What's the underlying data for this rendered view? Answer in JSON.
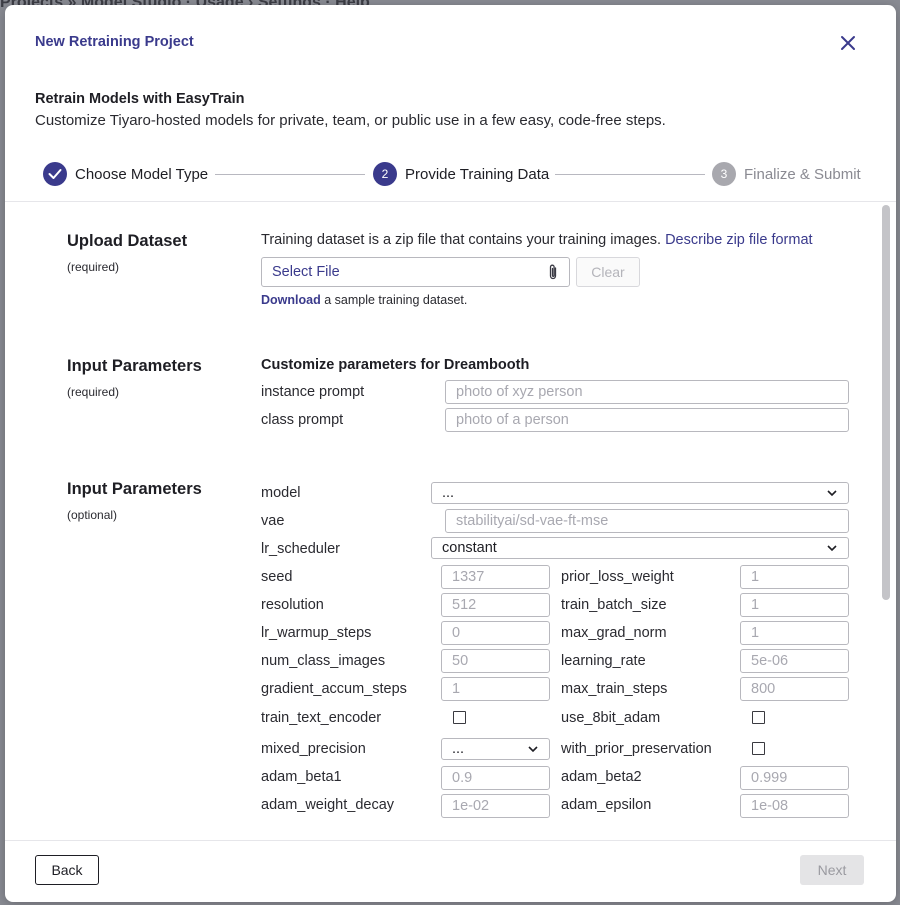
{
  "backdrop": {
    "text": "Projects  »  Model Studio  ·  Usage  ›  Settings  ·  Help"
  },
  "modal": {
    "title": "New Retraining Project",
    "intro_title": "Retrain Models with EasyTrain",
    "intro_subtitle": "Customize Tiyaro-hosted models for private, team, or public use in a few easy, code-free steps."
  },
  "stepper": {
    "steps": [
      {
        "number": "✓",
        "label": "Choose Model Type",
        "state": "completed"
      },
      {
        "number": "2",
        "label": "Provide Training Data",
        "state": "active"
      },
      {
        "number": "3",
        "label": "Finalize & Submit",
        "state": "pending"
      }
    ],
    "colors": {
      "completed": "#3a3a8c",
      "active": "#3a3a8c",
      "pending": "#a8a8ae"
    }
  },
  "upload": {
    "title": "Upload Dataset",
    "subtitle": "(required)",
    "description": "Training dataset is a zip file that contains your training images.",
    "describe_link": "Describe zip file format",
    "select_file": "Select File",
    "clear": "Clear",
    "download_link": "Download",
    "download_text": "a sample training dataset.",
    "icons": {
      "file": "paperclip-icon"
    }
  },
  "required_params": {
    "title": "Input Parameters",
    "subtitle": "(required)",
    "heading": "Customize parameters for Dreambooth",
    "instance_prompt": {
      "label": "instance prompt",
      "placeholder": "photo of xyz person",
      "value": ""
    },
    "class_prompt": {
      "label": "class prompt",
      "placeholder": "photo of a person",
      "value": ""
    }
  },
  "optional_params": {
    "title": "Input Parameters",
    "subtitle": "(optional)",
    "model": {
      "label": "model",
      "value": "..."
    },
    "vae": {
      "label": "vae",
      "placeholder": "stabilityai/sd-vae-ft-mse"
    },
    "lr_scheduler": {
      "label": "lr_scheduler",
      "value": "constant"
    },
    "seed": {
      "label": "seed",
      "placeholder": "1337"
    },
    "prior_loss_weight": {
      "label": "prior_loss_weight",
      "placeholder": "1"
    },
    "resolution": {
      "label": "resolution",
      "placeholder": "512"
    },
    "train_batch_size": {
      "label": "train_batch_size",
      "placeholder": "1"
    },
    "lr_warmup_steps": {
      "label": "lr_warmup_steps",
      "placeholder": "0"
    },
    "max_grad_norm": {
      "label": "max_grad_norm",
      "placeholder": "1"
    },
    "num_class_images": {
      "label": "num_class_images",
      "placeholder": "50"
    },
    "learning_rate": {
      "label": "learning_rate",
      "placeholder": "5e-06"
    },
    "gradient_accum_steps": {
      "label": "gradient_accum_steps",
      "placeholder": "1"
    },
    "max_train_steps": {
      "label": "max_train_steps",
      "placeholder": "800"
    },
    "train_text_encoder": {
      "label": "train_text_encoder",
      "checked": false
    },
    "use_8bit_adam": {
      "label": "use_8bit_adam",
      "checked": false
    },
    "mixed_precision": {
      "label": "mixed_precision",
      "value": "..."
    },
    "with_prior_preservation": {
      "label": "with_prior_preservation",
      "checked": false
    },
    "adam_beta1": {
      "label": "adam_beta1",
      "placeholder": "0.9"
    },
    "adam_beta2": {
      "label": "adam_beta2",
      "placeholder": "0.999"
    },
    "adam_weight_decay": {
      "label": "adam_weight_decay",
      "placeholder": "1e-02"
    },
    "adam_epsilon": {
      "label": "adam_epsilon",
      "placeholder": "1e-08"
    }
  },
  "footer": {
    "back": "Back",
    "next": "Next"
  },
  "colors": {
    "accent": "#3a3a8c",
    "disabled": "#e4e4e6"
  }
}
